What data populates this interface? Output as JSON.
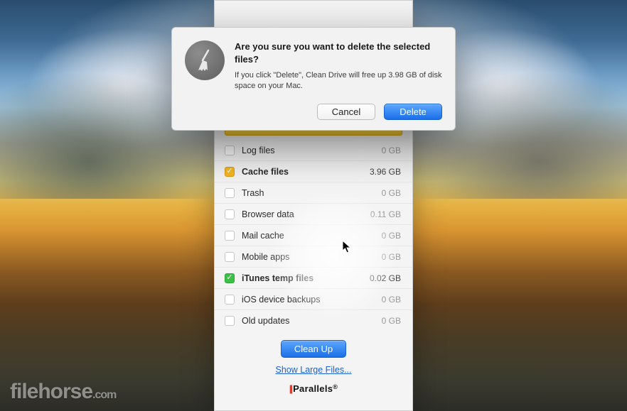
{
  "main": {
    "items": [
      {
        "label": "Log files",
        "size": "0 GB",
        "state": "unchecked"
      },
      {
        "label": "Cache files",
        "size": "3.96 GB",
        "state": "yellow"
      },
      {
        "label": "Trash",
        "size": "0 GB",
        "state": "unchecked"
      },
      {
        "label": "Browser data",
        "size": "0.11 GB",
        "state": "unchecked"
      },
      {
        "label": "Mail cache",
        "size": "0 GB",
        "state": "unchecked"
      },
      {
        "label": "Mobile apps",
        "size": "0 GB",
        "state": "unchecked"
      },
      {
        "label": "iTunes temp files",
        "size": "0.02 GB",
        "state": "green"
      },
      {
        "label": "iOS device backups",
        "size": "0 GB",
        "state": "unchecked"
      },
      {
        "label": "Old updates",
        "size": "0 GB",
        "state": "unchecked"
      }
    ],
    "cleanup_label": "Clean Up",
    "large_files_label": "Show Large Files...",
    "brand": "Parallels",
    "brand_r": "®"
  },
  "dialog": {
    "title": "Are you sure you want to delete the selected files?",
    "message": "If you click \"Delete\", Clean Drive will free up 3.98 GB of disk space on your Mac.",
    "cancel_label": "Cancel",
    "delete_label": "Delete",
    "icon_name": "broom-icon"
  },
  "watermark": {
    "text": "filehorse",
    "suffix": ".com"
  },
  "colors": {
    "accent": "#1a6fe8",
    "warn": "#f7b924",
    "ok": "#3cc147"
  }
}
